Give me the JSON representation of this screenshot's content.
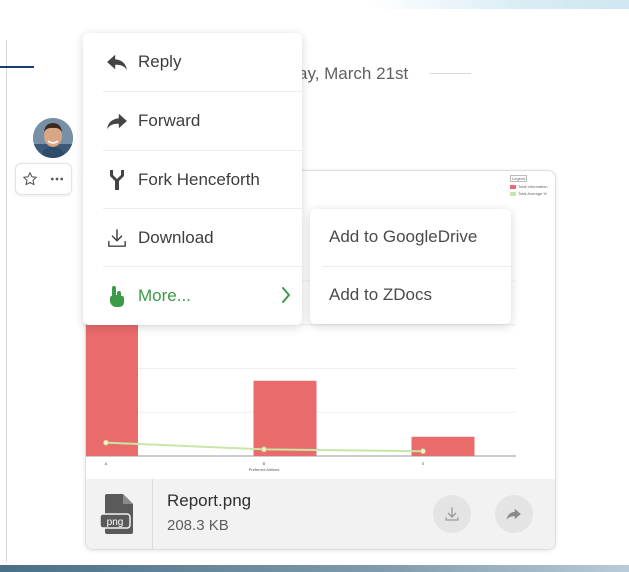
{
  "header": {
    "date_text": "ay, March 21st"
  },
  "message": {
    "avatar_icon": "user-avatar",
    "actions": [
      {
        "icon": "star-icon"
      },
      {
        "icon": "more-icon"
      }
    ]
  },
  "context_menu": {
    "items": [
      {
        "label": "Reply",
        "icon": "reply-icon"
      },
      {
        "label": "Forward",
        "icon": "forward-icon"
      },
      {
        "label": "Fork Henceforth",
        "icon": "fork-icon"
      },
      {
        "label": "Download",
        "icon": "download-icon"
      },
      {
        "label": "More...",
        "icon": "hand-pointer-icon",
        "active": true,
        "has_submenu": true
      }
    ],
    "active_color": "#3c9a48"
  },
  "submenu": {
    "items": [
      {
        "label": "Add to GoogleDrive"
      },
      {
        "label": "Add to ZDocs"
      }
    ]
  },
  "attachment": {
    "file_type": "png",
    "file_name": "Report.png",
    "file_size": "208.3 KB",
    "preview_chart": {
      "legend_title": "Legend",
      "legend_items": [
        "Total Information",
        "Total Average %"
      ],
      "xlabel": "Preferred Airlines",
      "categories": [
        "A",
        "B",
        "S"
      ],
      "bar_color": "#e96b6b",
      "line_color": "#c9e6a8",
      "bar_values": [
        100,
        43,
        11
      ],
      "line_values": [
        5,
        2.5,
        1.8
      ]
    }
  },
  "colors": {
    "bottom_bar": "#4a6f86",
    "top_gradient": "#cfe7f1"
  }
}
